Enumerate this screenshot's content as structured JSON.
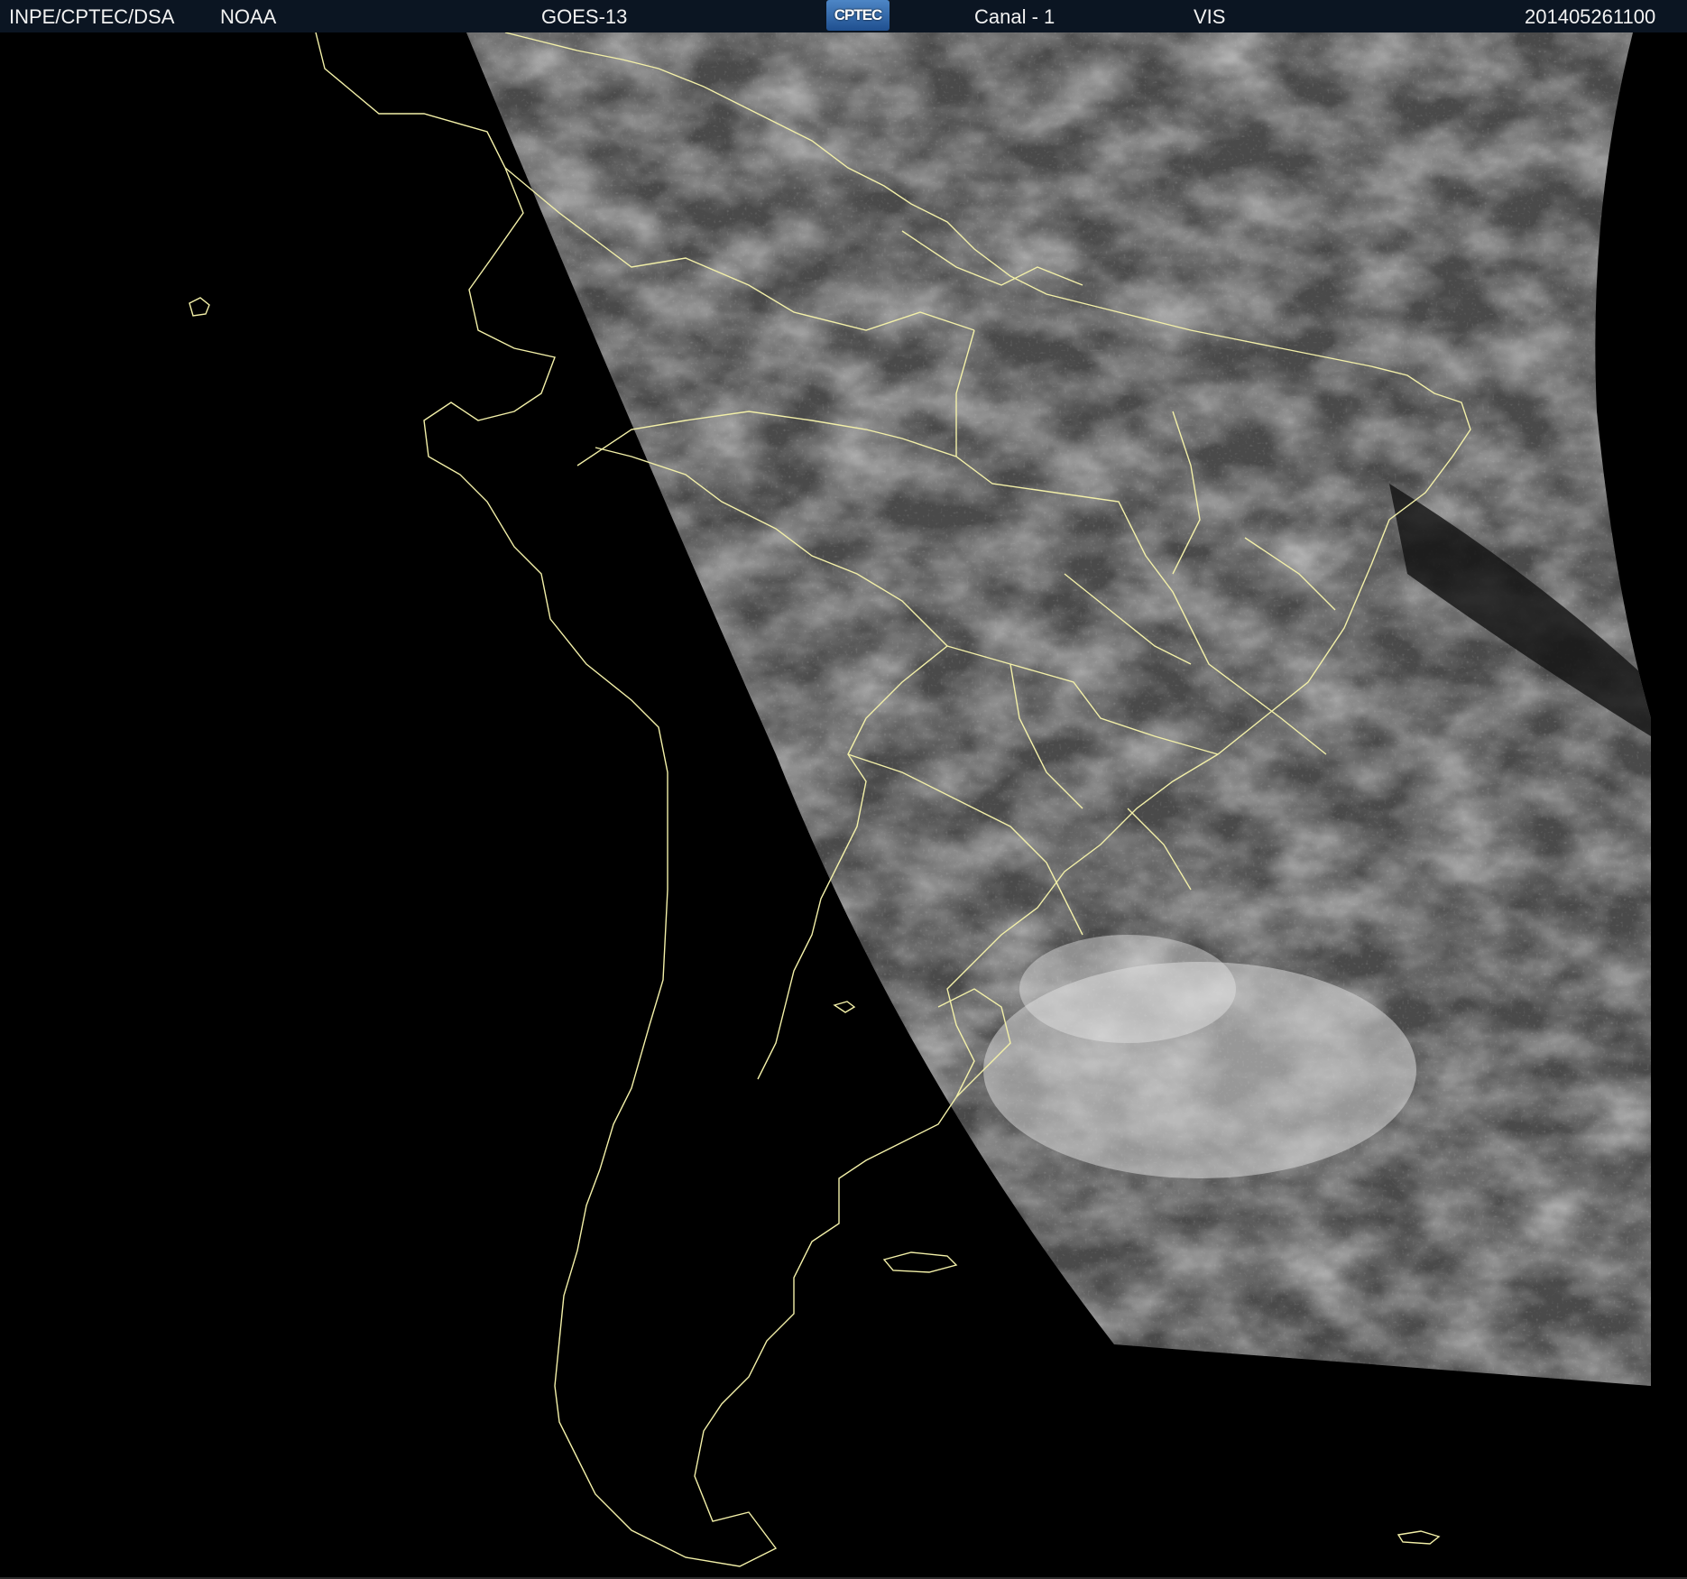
{
  "header": {
    "institution": "INPE/CPTEC/DSA",
    "agency": "NOAA",
    "satellite": "GOES-13",
    "logo_text": "CPTEC",
    "channel": "Canal - 1",
    "band": "VIS",
    "timestamp": "201405261100"
  },
  "map": {
    "region": "South America",
    "imagery": "visible satellite imagery",
    "boundary_color": "#f3f0a8",
    "cloud_color": "#bdbdbd",
    "background_color": "#000000"
  }
}
